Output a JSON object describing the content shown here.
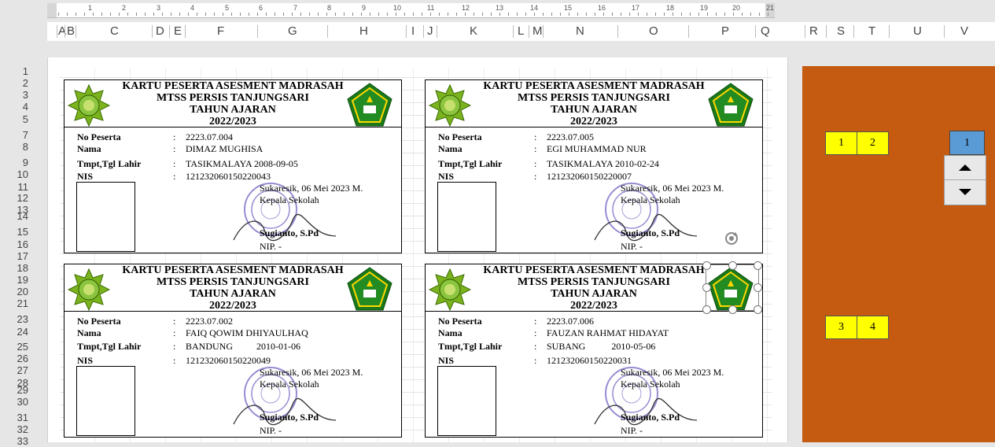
{
  "ruler": {
    "numbers": [
      "1",
      "2",
      "3",
      "4",
      "5",
      "6",
      "7",
      "8",
      "9",
      "10",
      "11",
      "12",
      "13",
      "14",
      "15",
      "16",
      "17",
      "18",
      "19",
      "20",
      "21"
    ]
  },
  "columns": [
    "A",
    "B",
    "C",
    "D",
    "E",
    "F",
    "G",
    "H",
    "I",
    "J",
    "K",
    "L",
    "M",
    "N",
    "O",
    "P",
    "Q",
    "R",
    "S",
    "T",
    "U",
    "V"
  ],
  "rows": [
    "1",
    "2",
    "3",
    "4",
    "5",
    "7",
    "8",
    "9",
    "10",
    "11",
    "12",
    "13",
    "14",
    "15",
    "16",
    "17",
    "18",
    "19",
    "20",
    "21",
    "23",
    "24",
    "25",
    "26",
    "27",
    "28",
    "29",
    "30",
    "31",
    "32",
    "33"
  ],
  "card_header": {
    "line1": "KARTU PESERTA ASESMENT MADRASAH",
    "line2": "MTSS PERSIS TANJUNGSARI",
    "line3": "TAHUN AJARAN",
    "line4": "2022/2023"
  },
  "field_labels": {
    "no": "No Peserta",
    "nama": "Nama",
    "ttl": "Tmpt,Tgl Lahir",
    "nis": "NIS",
    "colon": ":"
  },
  "signature": {
    "place_date": "Sukaresik, 06 Mei 2023 M.",
    "role": "Kepala Sekolah",
    "name": "Sugianto, S.Pd",
    "nip": "NIP. -"
  },
  "cards": [
    {
      "no": "2223.07.004",
      "nama": "DIMAZ MUGHISA",
      "ttl": "TASIKMALAYA 2008-09-05",
      "nis": "121232060150220043"
    },
    {
      "no": "2223.07.005",
      "nama": "EGI MUHAMMAD NUR",
      "ttl": "TASIKMALAYA 2010-02-24",
      "nis": "121232060150220007"
    },
    {
      "no": "2223.07.002",
      "nama": "FAIQ QOWIM DHIYAULHAQ",
      "ttl": "BANDUNG          2010-01-06",
      "nis": "121232060150220049"
    },
    {
      "no": "2223.07.006",
      "nama": "FAUZAN RAHMAT HIDAYAT",
      "ttl": "SUBANG           2010-05-06",
      "nis": "121232060150220031"
    }
  ],
  "controls": {
    "yellow": [
      "1",
      "2",
      "3",
      "4"
    ],
    "spinner_value": "1",
    "panel_color": "#c55a11"
  }
}
